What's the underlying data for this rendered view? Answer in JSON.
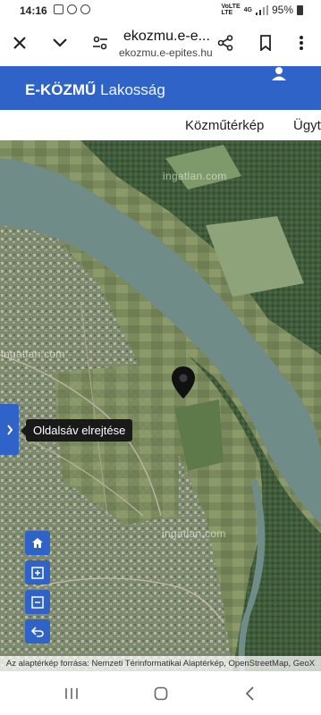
{
  "status": {
    "time": "14:16",
    "network_top": "VoLTE",
    "network_bottom": "LTE",
    "signal_label": "4G",
    "battery": "95%"
  },
  "browser": {
    "title": "ekozmu.e-e...",
    "url": "ekozmu.e-epites.hu"
  },
  "header": {
    "brand_strong": "E-KÖZMŰ",
    "brand_light": "Lakosság"
  },
  "nav": {
    "items": [
      "Közműtérkép",
      "Ügyt"
    ]
  },
  "map": {
    "watermarks": [
      "ingatlan.com",
      "ingatlan.com",
      "ingatlan.com"
    ],
    "tooltip": "Oldalsáv elrejtése",
    "attribution": "Az alaptérkép forrása: Nemzeti Térinformatikai Alaptérkép, OpenStreetMap, GeoX"
  },
  "icons": {
    "close": "close-icon",
    "chevron": "chevron-down-icon",
    "tune": "tune-icon",
    "share": "share-icon",
    "bookmark": "bookmark-icon",
    "more": "more-vert-icon",
    "user": "user-icon",
    "pin": "map-pin-icon",
    "home": "home-icon",
    "zoom_in": "zoom-in-icon",
    "zoom_out": "zoom-out-icon",
    "back": "undo-icon"
  },
  "colors": {
    "accent": "#2f63c7",
    "river": "#6f8c88",
    "forest": "#3f5a3a"
  }
}
